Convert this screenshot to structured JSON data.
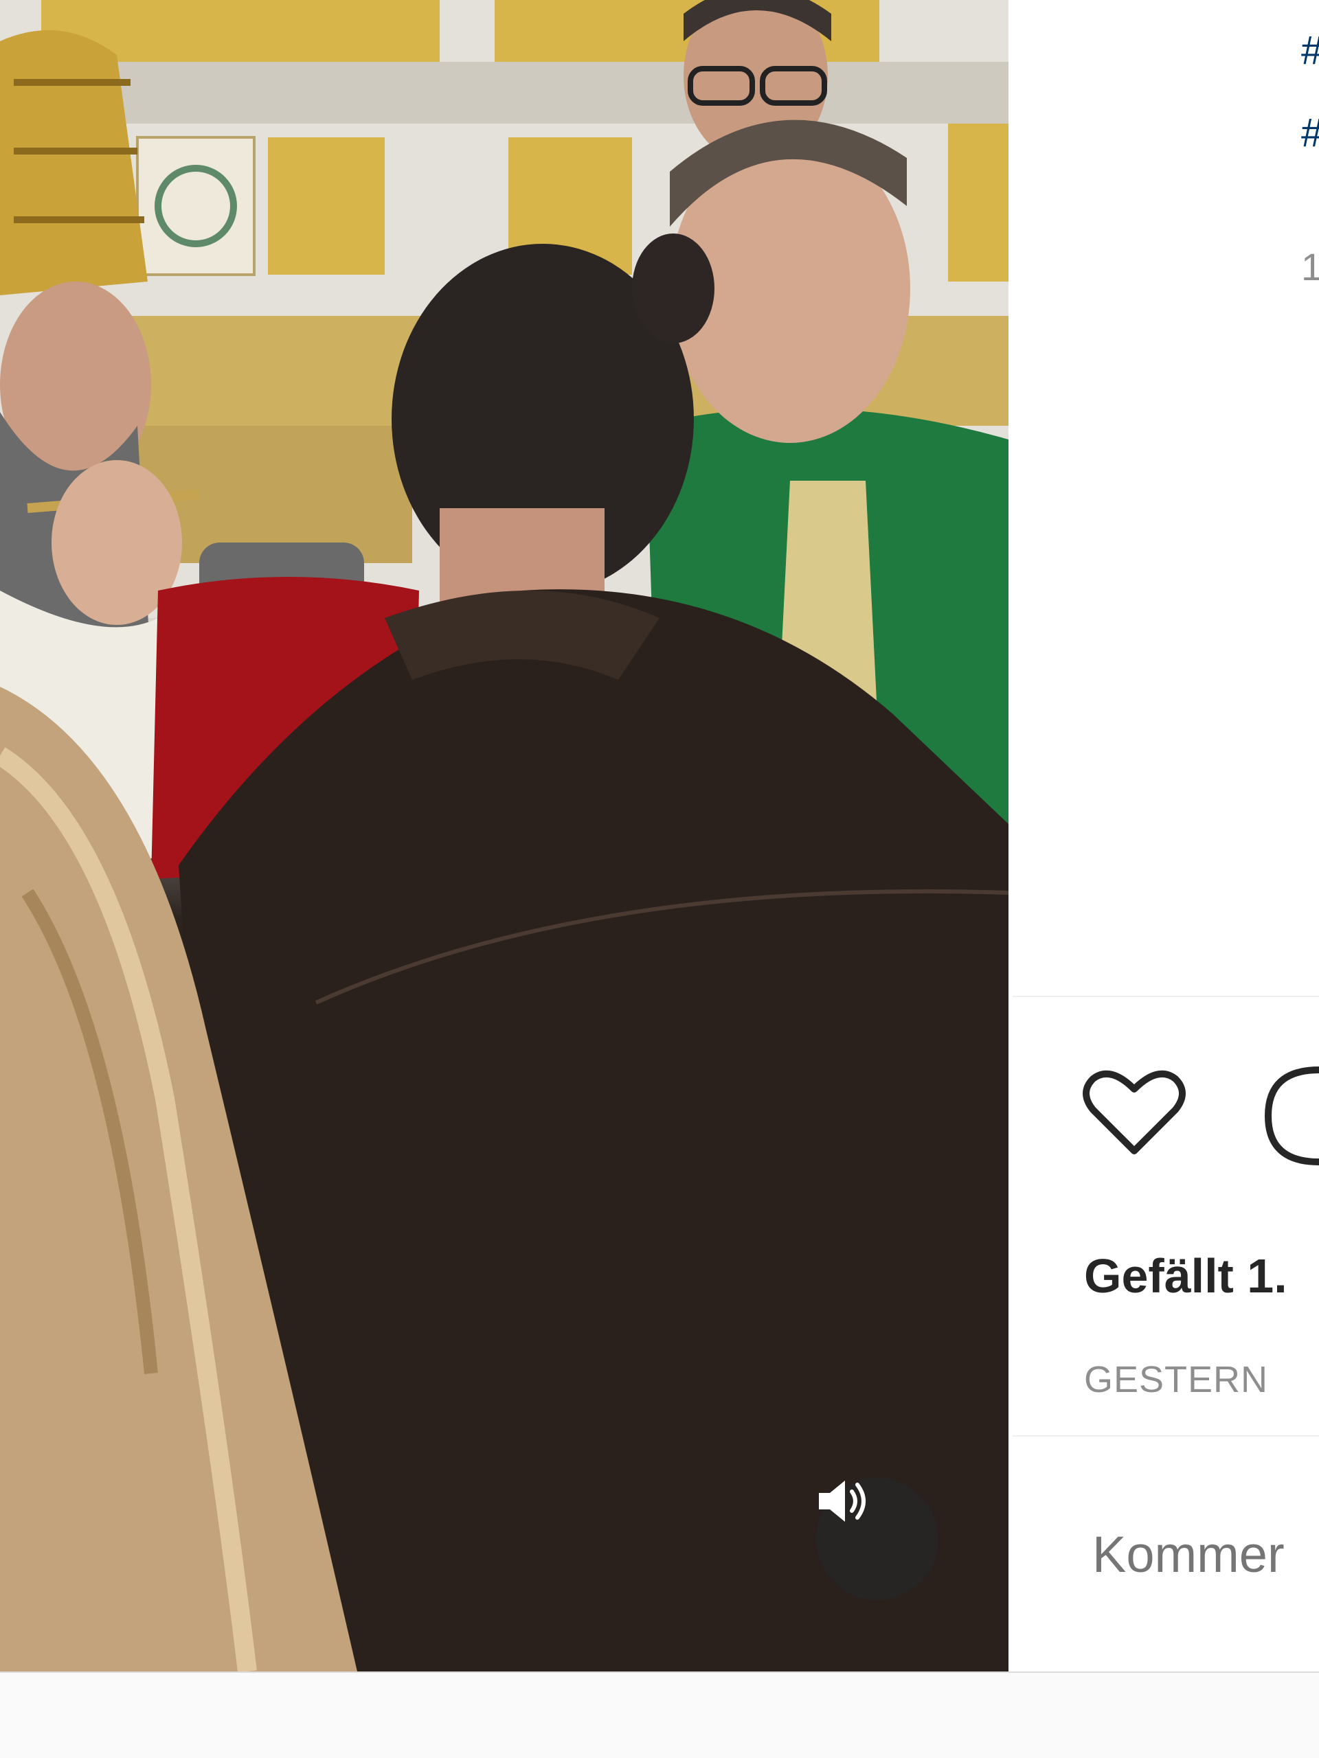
{
  "post": {
    "caption_hashtags": [
      "#",
      "#"
    ],
    "timestamp_partial": "1",
    "likes_label": "Gefällt 1.",
    "date_label": "GESTERN",
    "comment_placeholder": "Kommer"
  },
  "icons": {
    "sound": "speaker-icon",
    "like": "heart-icon",
    "comment": "comment-icon"
  },
  "colors": {
    "hashtag": "#00376b",
    "muted": "#8e8e8e",
    "text": "#262626"
  }
}
